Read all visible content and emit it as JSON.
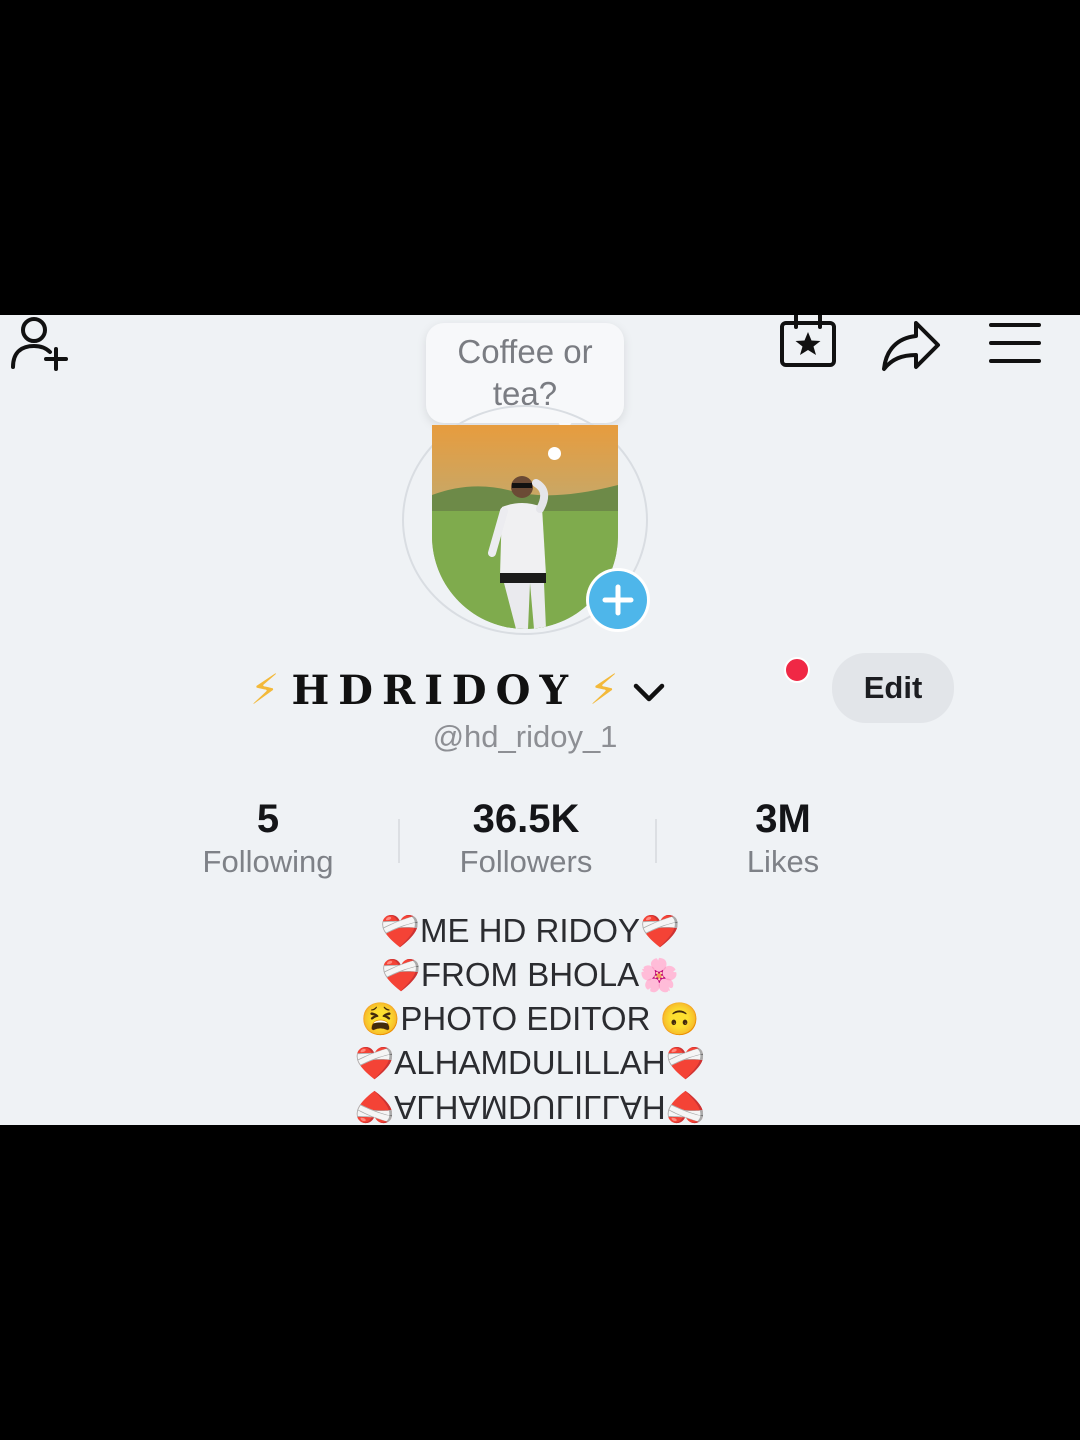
{
  "colors": {
    "accent": "#4eb6ea",
    "notification": "#f02845",
    "bolt": "#f3b93a",
    "background": "#eff2f5"
  },
  "icons": {
    "add_friend": "add-friend-icon",
    "calendar": "calendar-star-icon",
    "share": "share-arrow-icon",
    "menu": "hamburger-menu-icon",
    "add_story": "plus-icon",
    "verified": "chevron-down-icon"
  },
  "note": {
    "text": "Coffee or tea?"
  },
  "profile": {
    "bolt": "⚡",
    "apple": "",
    "display_name": "HDRIDOY",
    "username": "@hd_ridoy_1",
    "edit_label": "Edit"
  },
  "stats": {
    "following": {
      "value": "5",
      "label": "Following"
    },
    "followers": {
      "value": "36.5K",
      "label": "Followers"
    },
    "likes": {
      "value": "3M",
      "label": "Likes"
    }
  },
  "bio": {
    "line1": {
      "emoji_left": "❤️‍🩹",
      "text": "ME HD RIDOY",
      "emoji_right": "❤️‍🩹"
    },
    "line2": {
      "emoji_left": "❤️‍🩹",
      "text": "FROM BHOLA",
      "emoji_right": "🌸"
    },
    "line3": {
      "emoji_left": "😫",
      "text": "PHOTO EDITOR ",
      "emoji_right": "🙃"
    },
    "line4": {
      "emoji_left": "❤️‍🩹",
      "text": "ALHAMDULILLAH",
      "emoji_right": "❤️‍🩹"
    },
    "line5": {
      "emoji_left": "❤️‍🩹",
      "text": "ALHAMDULILLAH",
      "emoji_right": "❤️‍🩹"
    }
  }
}
